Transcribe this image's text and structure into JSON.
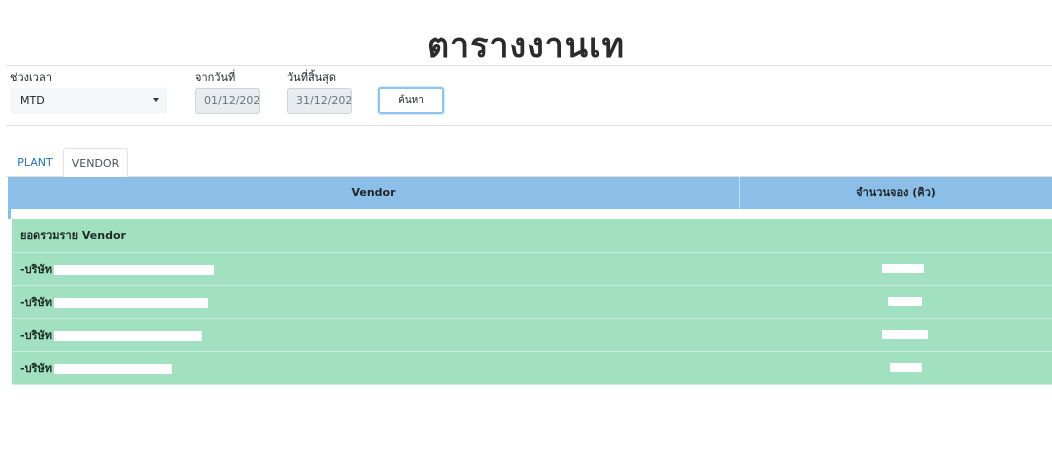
{
  "page": {
    "title": "ตารางงานเท"
  },
  "filters": {
    "period_label": "ช่วงเวลา",
    "period_value": "MTD",
    "from_label": "จากวันที่",
    "from_value": "01/12/202",
    "to_label": "วันที่สิ้นสุด",
    "to_value": "31/12/202",
    "search_label": "ค้นหา"
  },
  "tabs": [
    {
      "label": "PLANT",
      "active": false
    },
    {
      "label": "VENDOR",
      "active": true
    }
  ],
  "table": {
    "columns": [
      "Vendor",
      "จำนวนจอง (คิว)"
    ],
    "total_row_label": "ยอดรวมราย Vendor",
    "rows": [
      {
        "vendor_prefix": "-บริษัท",
        "redacted": true
      },
      {
        "vendor_prefix": "-บริษัท",
        "redacted": true
      },
      {
        "vendor_prefix": "-บริษัท",
        "redacted": true
      },
      {
        "vendor_prefix": "-บริษัท",
        "redacted": true
      }
    ]
  },
  "colors": {
    "header_bg": "#8bbfe8",
    "row_bg": "#a1e1c2",
    "tab_link": "#1a73c9",
    "button_border": "#8ec5ea"
  }
}
